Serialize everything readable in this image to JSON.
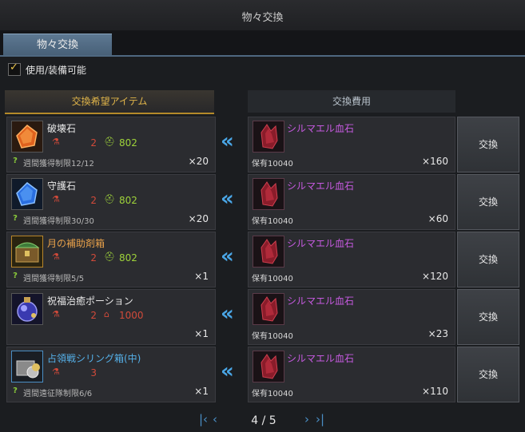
{
  "window": {
    "title": "物々交換"
  },
  "tabs": [
    {
      "label": "物々交換"
    }
  ],
  "filter": {
    "label": "使用/装備可能",
    "checked": true
  },
  "headers": {
    "item": "交換希望アイテム",
    "cost": "交換費用"
  },
  "rows": [
    {
      "name": "破壊石",
      "name_color": "white",
      "level": "2",
      "stat_icon": "helmet-icon",
      "stat": "802",
      "stat_color": "#9ed23a",
      "limit": "週間獲得制限12/12",
      "qty": "×20",
      "cost_name": "シルマエル血石",
      "owned": "保有10040",
      "cost_qty": "×160",
      "button": "交換"
    },
    {
      "name": "守護石",
      "name_color": "white",
      "level": "2",
      "stat_icon": "helmet-icon",
      "stat": "802",
      "stat_color": "#9ed23a",
      "limit": "週間獲得制限30/30",
      "qty": "×20",
      "cost_name": "シルマエル血石",
      "owned": "保有10040",
      "cost_qty": "×60",
      "button": "交換"
    },
    {
      "name": "月の補助剤箱",
      "name_color": "orange",
      "level": "2",
      "stat_icon": "helmet-icon",
      "stat": "802",
      "stat_color": "#9ed23a",
      "limit": "週間獲得制限5/5",
      "qty": "×1",
      "cost_name": "シルマエル血石",
      "owned": "保有10040",
      "cost_qty": "×120",
      "button": "交換"
    },
    {
      "name": "祝福治癒ポーション",
      "name_color": "white",
      "level": "2",
      "stat_icon": "house-icon",
      "stat": "1000",
      "stat_color": "#d14a3a",
      "limit": "",
      "qty": "×1",
      "cost_name": "シルマエル血石",
      "owned": "保有10040",
      "cost_qty": "×23",
      "button": "交換"
    },
    {
      "name": "占領戦シリング箱(中)",
      "name_color": "blue",
      "level": "3",
      "stat_icon": "",
      "stat": "",
      "stat_color": "",
      "limit": "週間遠征隊制限6/6",
      "qty": "×1",
      "cost_name": "シルマエル血石",
      "owned": "保有10040",
      "cost_qty": "×110",
      "button": "交換"
    }
  ],
  "pager": {
    "text": "4 / 5"
  },
  "colors": {
    "accent_gold": "#e2b64a",
    "arrow_blue": "#4aa6e6",
    "cost_purple": "#c65ae0"
  }
}
